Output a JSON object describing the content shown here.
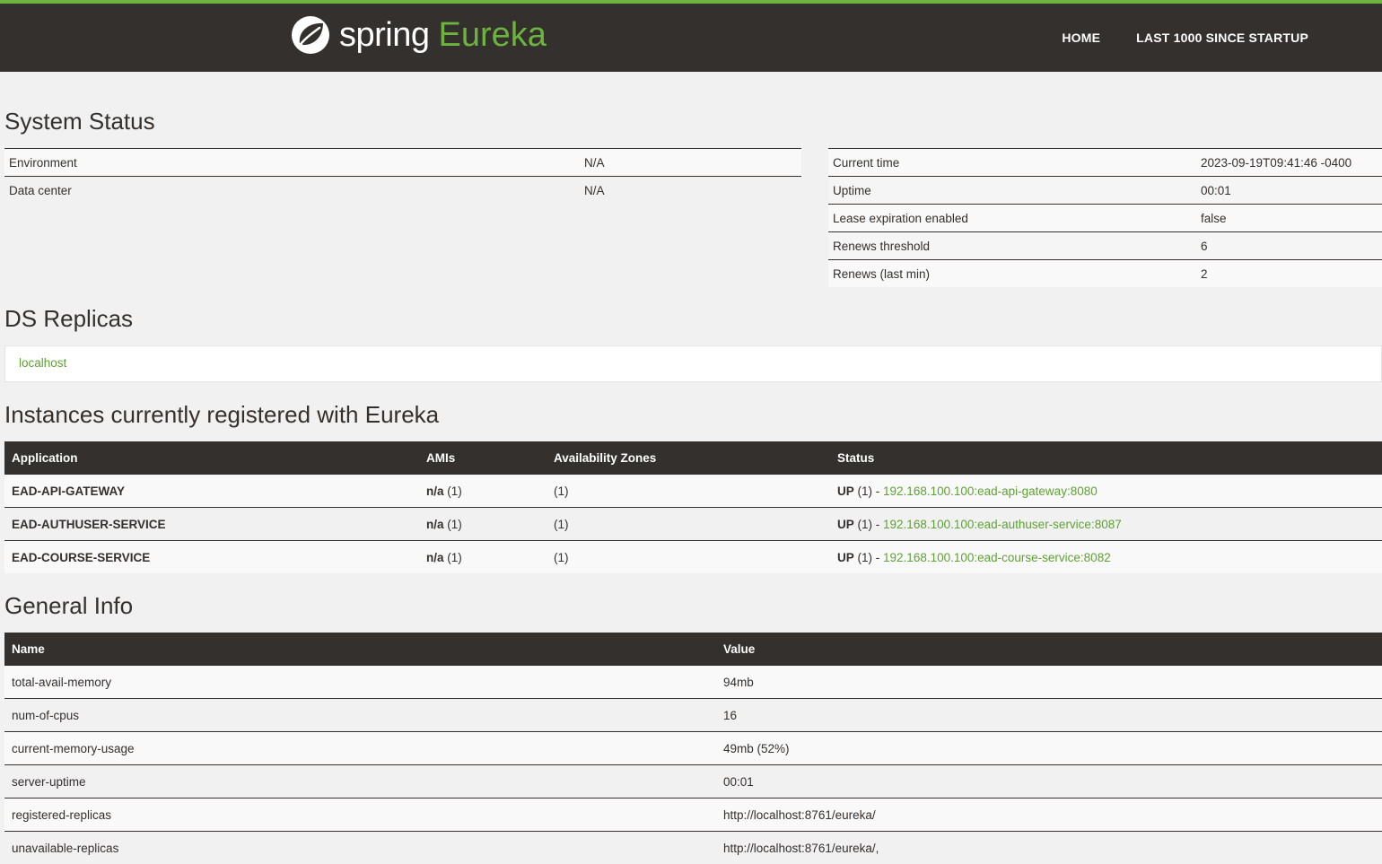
{
  "brand": {
    "spring": "spring",
    "eureka": "Eureka"
  },
  "colors": {
    "accent": "#6db33f",
    "nav": "#34302d"
  },
  "nav": {
    "home": "HOME",
    "last1000": "LAST 1000 SINCE STARTUP"
  },
  "system_status": {
    "title": "System Status",
    "left": [
      {
        "k": "Environment",
        "v": "N/A"
      },
      {
        "k": "Data center",
        "v": "N/A"
      }
    ],
    "right": [
      {
        "k": "Current time",
        "v": "2023-09-19T09:41:46 -0400"
      },
      {
        "k": "Uptime",
        "v": "00:01"
      },
      {
        "k": "Lease expiration enabled",
        "v": "false"
      },
      {
        "k": "Renews threshold",
        "v": "6"
      },
      {
        "k": "Renews (last min)",
        "v": "2"
      }
    ]
  },
  "replicas": {
    "title": "DS Replicas",
    "item": "localhost"
  },
  "instances": {
    "title": "Instances currently registered with Eureka",
    "headers": [
      "Application",
      "AMIs",
      "Availability Zones",
      "Status"
    ],
    "rows": [
      {
        "app": "EAD-API-GATEWAY",
        "ami": "n/a",
        "ami_count": "(1)",
        "zones": "(1)",
        "status": "UP",
        "status_count": "(1) - ",
        "link": "192.168.100.100:ead-api-gateway:8080"
      },
      {
        "app": "EAD-AUTHUSER-SERVICE",
        "ami": "n/a",
        "ami_count": "(1)",
        "zones": "(1)",
        "status": "UP",
        "status_count": "(1) - ",
        "link": "192.168.100.100:ead-authuser-service:8087"
      },
      {
        "app": "EAD-COURSE-SERVICE",
        "ami": "n/a",
        "ami_count": "(1)",
        "zones": "(1)",
        "status": "UP",
        "status_count": "(1) - ",
        "link": "192.168.100.100:ead-course-service:8082"
      }
    ]
  },
  "general": {
    "title": "General Info",
    "headers": [
      "Name",
      "Value"
    ],
    "rows": [
      {
        "k": "total-avail-memory",
        "v": "94mb"
      },
      {
        "k": "num-of-cpus",
        "v": "16"
      },
      {
        "k": "current-memory-usage",
        "v": "49mb (52%)"
      },
      {
        "k": "server-uptime",
        "v": "00:01"
      },
      {
        "k": "registered-replicas",
        "v": "http://localhost:8761/eureka/"
      },
      {
        "k": "unavailable-replicas",
        "v": "http://localhost:8761/eureka/,"
      }
    ]
  }
}
